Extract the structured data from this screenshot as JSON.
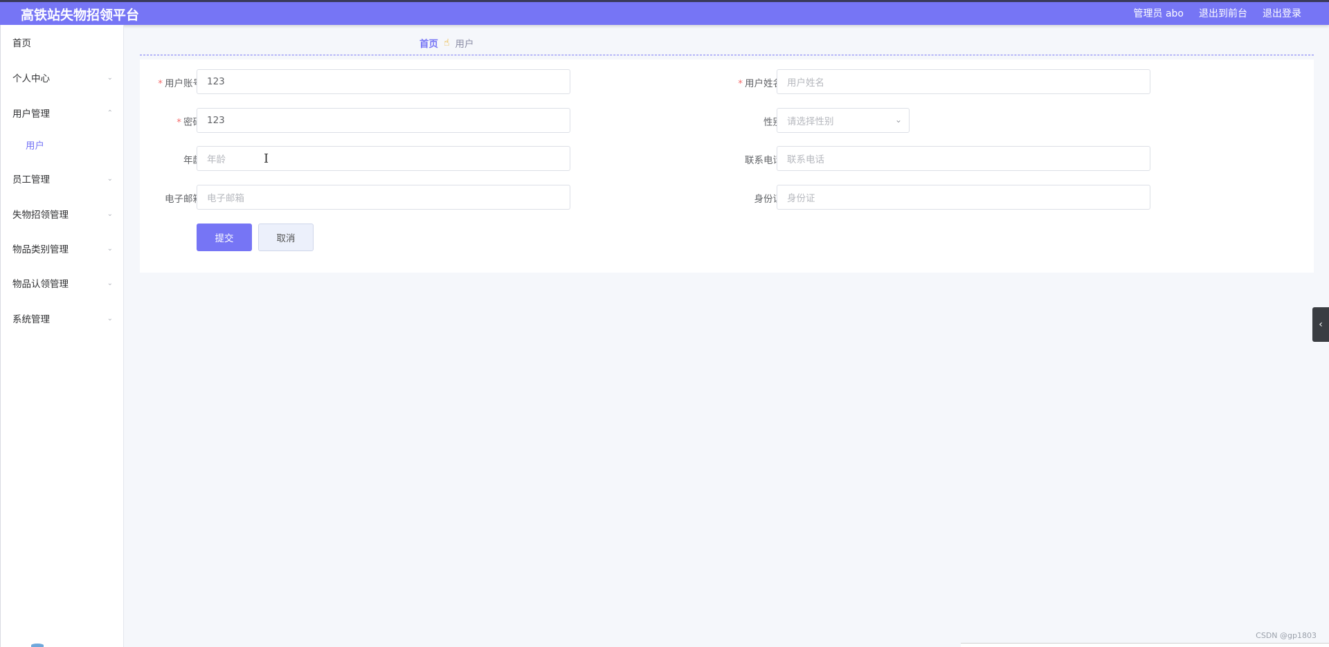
{
  "header": {
    "title": "高铁站失物招领平台",
    "user_label": "管理员 abo",
    "to_front_label": "退出到前台",
    "logout_label": "退出登录"
  },
  "sidebar": {
    "items": [
      {
        "label": "首页"
      },
      {
        "label": "个人中心",
        "chevron": "⌄"
      },
      {
        "label": "用户管理",
        "chevron": "⌃"
      },
      {
        "label": "员工管理",
        "chevron": "⌄"
      },
      {
        "label": "失物招领管理",
        "chevron": "⌄"
      },
      {
        "label": "物品类别管理",
        "chevron": "⌄"
      },
      {
        "label": "物品认领管理",
        "chevron": "⌄"
      },
      {
        "label": "系统管理",
        "chevron": "⌄"
      }
    ],
    "submenu": {
      "label": "用户"
    }
  },
  "breadcrumb": {
    "home": "首页",
    "current": "用户"
  },
  "form": {
    "account": {
      "label": "用户账号",
      "value": "123"
    },
    "name": {
      "label": "用户姓名",
      "placeholder": "用户姓名"
    },
    "password": {
      "label": "密码",
      "value": "123"
    },
    "gender": {
      "label": "性别",
      "placeholder": "请选择性别"
    },
    "age": {
      "label": "年龄",
      "placeholder": "年龄"
    },
    "phone": {
      "label": "联系电话",
      "placeholder": "联系电话"
    },
    "email": {
      "label": "电子邮箱",
      "placeholder": "电子邮箱"
    },
    "idcard": {
      "label": "身份证",
      "placeholder": "身份证"
    },
    "submit_label": "提交",
    "cancel_label": "取消"
  },
  "watermark": "CSDN @gp1803",
  "colors": {
    "accent": "#7675f5",
    "required": "#f56c6c"
  },
  "icons": {
    "breadcrumb": "hand-pointer-icon",
    "toggle": "chevron-left-icon"
  }
}
